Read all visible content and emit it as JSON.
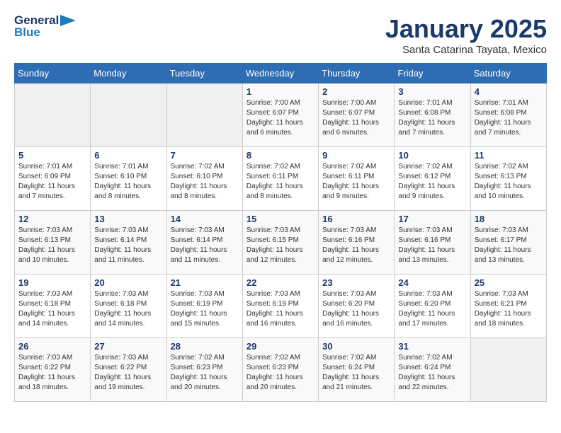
{
  "logo": {
    "line1": "General",
    "line2": "Blue"
  },
  "title": "January 2025",
  "subtitle": "Santa Catarina Tayata, Mexico",
  "days_header": [
    "Sunday",
    "Monday",
    "Tuesday",
    "Wednesday",
    "Thursday",
    "Friday",
    "Saturday"
  ],
  "weeks": [
    [
      {
        "day": "",
        "info": ""
      },
      {
        "day": "",
        "info": ""
      },
      {
        "day": "",
        "info": ""
      },
      {
        "day": "1",
        "info": "Sunrise: 7:00 AM\nSunset: 6:07 PM\nDaylight: 11 hours\nand 6 minutes."
      },
      {
        "day": "2",
        "info": "Sunrise: 7:00 AM\nSunset: 6:07 PM\nDaylight: 11 hours\nand 6 minutes."
      },
      {
        "day": "3",
        "info": "Sunrise: 7:01 AM\nSunset: 6:08 PM\nDaylight: 11 hours\nand 7 minutes."
      },
      {
        "day": "4",
        "info": "Sunrise: 7:01 AM\nSunset: 6:08 PM\nDaylight: 11 hours\nand 7 minutes."
      }
    ],
    [
      {
        "day": "5",
        "info": "Sunrise: 7:01 AM\nSunset: 6:09 PM\nDaylight: 11 hours\nand 7 minutes."
      },
      {
        "day": "6",
        "info": "Sunrise: 7:01 AM\nSunset: 6:10 PM\nDaylight: 11 hours\nand 8 minutes."
      },
      {
        "day": "7",
        "info": "Sunrise: 7:02 AM\nSunset: 6:10 PM\nDaylight: 11 hours\nand 8 minutes."
      },
      {
        "day": "8",
        "info": "Sunrise: 7:02 AM\nSunset: 6:11 PM\nDaylight: 11 hours\nand 8 minutes."
      },
      {
        "day": "9",
        "info": "Sunrise: 7:02 AM\nSunset: 6:11 PM\nDaylight: 11 hours\nand 9 minutes."
      },
      {
        "day": "10",
        "info": "Sunrise: 7:02 AM\nSunset: 6:12 PM\nDaylight: 11 hours\nand 9 minutes."
      },
      {
        "day": "11",
        "info": "Sunrise: 7:02 AM\nSunset: 6:13 PM\nDaylight: 11 hours\nand 10 minutes."
      }
    ],
    [
      {
        "day": "12",
        "info": "Sunrise: 7:03 AM\nSunset: 6:13 PM\nDaylight: 11 hours\nand 10 minutes."
      },
      {
        "day": "13",
        "info": "Sunrise: 7:03 AM\nSunset: 6:14 PM\nDaylight: 11 hours\nand 11 minutes."
      },
      {
        "day": "14",
        "info": "Sunrise: 7:03 AM\nSunset: 6:14 PM\nDaylight: 11 hours\nand 11 minutes."
      },
      {
        "day": "15",
        "info": "Sunrise: 7:03 AM\nSunset: 6:15 PM\nDaylight: 11 hours\nand 12 minutes."
      },
      {
        "day": "16",
        "info": "Sunrise: 7:03 AM\nSunset: 6:16 PM\nDaylight: 11 hours\nand 12 minutes."
      },
      {
        "day": "17",
        "info": "Sunrise: 7:03 AM\nSunset: 6:16 PM\nDaylight: 11 hours\nand 13 minutes."
      },
      {
        "day": "18",
        "info": "Sunrise: 7:03 AM\nSunset: 6:17 PM\nDaylight: 11 hours\nand 13 minutes."
      }
    ],
    [
      {
        "day": "19",
        "info": "Sunrise: 7:03 AM\nSunset: 6:18 PM\nDaylight: 11 hours\nand 14 minutes."
      },
      {
        "day": "20",
        "info": "Sunrise: 7:03 AM\nSunset: 6:18 PM\nDaylight: 11 hours\nand 14 minutes."
      },
      {
        "day": "21",
        "info": "Sunrise: 7:03 AM\nSunset: 6:19 PM\nDaylight: 11 hours\nand 15 minutes."
      },
      {
        "day": "22",
        "info": "Sunrise: 7:03 AM\nSunset: 6:19 PM\nDaylight: 11 hours\nand 16 minutes."
      },
      {
        "day": "23",
        "info": "Sunrise: 7:03 AM\nSunset: 6:20 PM\nDaylight: 11 hours\nand 16 minutes."
      },
      {
        "day": "24",
        "info": "Sunrise: 7:03 AM\nSunset: 6:20 PM\nDaylight: 11 hours\nand 17 minutes."
      },
      {
        "day": "25",
        "info": "Sunrise: 7:03 AM\nSunset: 6:21 PM\nDaylight: 11 hours\nand 18 minutes."
      }
    ],
    [
      {
        "day": "26",
        "info": "Sunrise: 7:03 AM\nSunset: 6:22 PM\nDaylight: 11 hours\nand 18 minutes."
      },
      {
        "day": "27",
        "info": "Sunrise: 7:03 AM\nSunset: 6:22 PM\nDaylight: 11 hours\nand 19 minutes."
      },
      {
        "day": "28",
        "info": "Sunrise: 7:02 AM\nSunset: 6:23 PM\nDaylight: 11 hours\nand 20 minutes."
      },
      {
        "day": "29",
        "info": "Sunrise: 7:02 AM\nSunset: 6:23 PM\nDaylight: 11 hours\nand 20 minutes."
      },
      {
        "day": "30",
        "info": "Sunrise: 7:02 AM\nSunset: 6:24 PM\nDaylight: 11 hours\nand 21 minutes."
      },
      {
        "day": "31",
        "info": "Sunrise: 7:02 AM\nSunset: 6:24 PM\nDaylight: 11 hours\nand 22 minutes."
      },
      {
        "day": "",
        "info": ""
      }
    ]
  ]
}
